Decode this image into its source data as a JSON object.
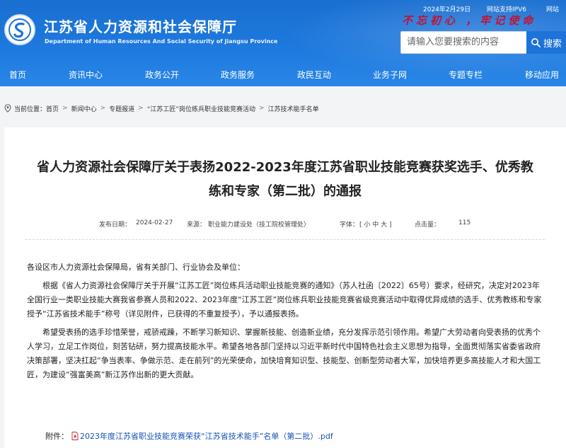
{
  "header": {
    "title": "江苏省人力资源和社会保障厅",
    "subtitle": "Department of Human Resources And Social Security of Jiangsu Province",
    "date": "2024年2月29日",
    "ipv6": "网站支持IPV6",
    "topbar_right": "网站",
    "slogan": "不忘初心 ，牢记使命",
    "search_placeholder": "请输入您要搜索的内容",
    "search_button": "搜索"
  },
  "nav": [
    "首页",
    "资讯中心",
    "政务公开",
    "政务服务",
    "政民互动",
    "业务子网",
    "专题专栏",
    "移动应用"
  ],
  "breadcrumb": {
    "label": "当前位置：",
    "items": [
      "首页",
      "新闻中心",
      "专题报道",
      "“江苏工匠”岗位练兵职业技能竞赛活动",
      "江苏技术能手名单"
    ]
  },
  "article": {
    "title": "省人力资源社会保障厅关于表扬2022-2023年度江苏省职业技能竞赛获奖选手、优秀教练和专家（第二批）的通报",
    "publish_label": "发布日期：",
    "publish_date": "2024-02-27",
    "source_label": "来源：",
    "source": "职业能力建设处（技工院校管理处）",
    "fontsize_label": "字体：",
    "fontsize_options": "[ 小 中 大 ]",
    "clicks_label": "点击量：",
    "clicks": "115",
    "para1": "各设区市人力资源社会保障局，省有关部门、行业协会及单位：",
    "para2": "根据《省人力资源社会保障厅关于开展“江苏工匠”岗位练兵活动职业技能竞赛的通知》（苏人社函〔2022〕65号）要求，经研究，决定对2023年全国行业一类职业技能大赛我省参赛人员和2022、2023年度“江苏工匠”岗位练兵职业技能竞赛省级竞赛活动中取得优异成绩的选手、优秀教练和专家授予“江苏省技术能手”称号（详见附件，已获得的不重复授予），予以通报表扬。",
    "para3": "希望受表扬的选手珍惜荣誉，戒骄戒躁，不断学习新知识、掌握新技能、创造新业绩，充分发挥示范引领作用。希望广大劳动者向受表扬的优秀个人学习，立足工作岗位，刻苦钻研，努力提高技能水平。希望各地各部门坚持以习近平新时代中国特色社会主义思想为指导，全面贯彻落实省委省政府决策部署，坚决扛起“争当表率、争做示范、走在前列”的光荣使命，加快培育知识型、技能型、创新型劳动者大军，加快培养更多高技能人才和大国工匠，为建设“强富美高”新江苏作出新的更大贡献。",
    "attachment_label": "附件：",
    "attachment_link": "2023年度江苏省职业技能竞赛荣获“江苏省技术能手”名单（第二批）.pdf"
  },
  "colors": {
    "header_blue": "#1e7adf",
    "slogan_red": "#c8102e",
    "link_blue": "#1452b8"
  }
}
